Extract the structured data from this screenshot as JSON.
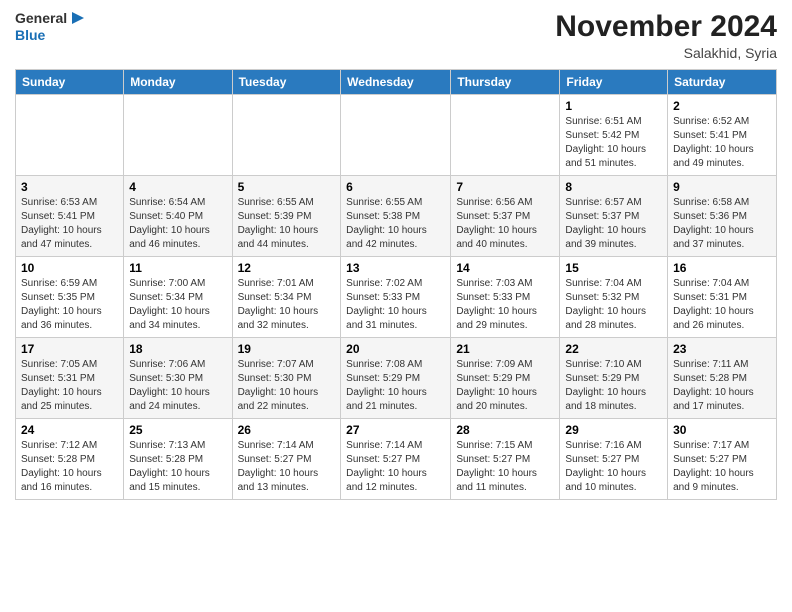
{
  "header": {
    "logo_general": "General",
    "logo_blue": "Blue",
    "month": "November 2024",
    "location": "Salakhid, Syria"
  },
  "days_of_week": [
    "Sunday",
    "Monday",
    "Tuesday",
    "Wednesday",
    "Thursday",
    "Friday",
    "Saturday"
  ],
  "weeks": [
    [
      {
        "day": "",
        "info": ""
      },
      {
        "day": "",
        "info": ""
      },
      {
        "day": "",
        "info": ""
      },
      {
        "day": "",
        "info": ""
      },
      {
        "day": "",
        "info": ""
      },
      {
        "day": "1",
        "info": "Sunrise: 6:51 AM\nSunset: 5:42 PM\nDaylight: 10 hours\nand 51 minutes."
      },
      {
        "day": "2",
        "info": "Sunrise: 6:52 AM\nSunset: 5:41 PM\nDaylight: 10 hours\nand 49 minutes."
      }
    ],
    [
      {
        "day": "3",
        "info": "Sunrise: 6:53 AM\nSunset: 5:41 PM\nDaylight: 10 hours\nand 47 minutes."
      },
      {
        "day": "4",
        "info": "Sunrise: 6:54 AM\nSunset: 5:40 PM\nDaylight: 10 hours\nand 46 minutes."
      },
      {
        "day": "5",
        "info": "Sunrise: 6:55 AM\nSunset: 5:39 PM\nDaylight: 10 hours\nand 44 minutes."
      },
      {
        "day": "6",
        "info": "Sunrise: 6:55 AM\nSunset: 5:38 PM\nDaylight: 10 hours\nand 42 minutes."
      },
      {
        "day": "7",
        "info": "Sunrise: 6:56 AM\nSunset: 5:37 PM\nDaylight: 10 hours\nand 40 minutes."
      },
      {
        "day": "8",
        "info": "Sunrise: 6:57 AM\nSunset: 5:37 PM\nDaylight: 10 hours\nand 39 minutes."
      },
      {
        "day": "9",
        "info": "Sunrise: 6:58 AM\nSunset: 5:36 PM\nDaylight: 10 hours\nand 37 minutes."
      }
    ],
    [
      {
        "day": "10",
        "info": "Sunrise: 6:59 AM\nSunset: 5:35 PM\nDaylight: 10 hours\nand 36 minutes."
      },
      {
        "day": "11",
        "info": "Sunrise: 7:00 AM\nSunset: 5:34 PM\nDaylight: 10 hours\nand 34 minutes."
      },
      {
        "day": "12",
        "info": "Sunrise: 7:01 AM\nSunset: 5:34 PM\nDaylight: 10 hours\nand 32 minutes."
      },
      {
        "day": "13",
        "info": "Sunrise: 7:02 AM\nSunset: 5:33 PM\nDaylight: 10 hours\nand 31 minutes."
      },
      {
        "day": "14",
        "info": "Sunrise: 7:03 AM\nSunset: 5:33 PM\nDaylight: 10 hours\nand 29 minutes."
      },
      {
        "day": "15",
        "info": "Sunrise: 7:04 AM\nSunset: 5:32 PM\nDaylight: 10 hours\nand 28 minutes."
      },
      {
        "day": "16",
        "info": "Sunrise: 7:04 AM\nSunset: 5:31 PM\nDaylight: 10 hours\nand 26 minutes."
      }
    ],
    [
      {
        "day": "17",
        "info": "Sunrise: 7:05 AM\nSunset: 5:31 PM\nDaylight: 10 hours\nand 25 minutes."
      },
      {
        "day": "18",
        "info": "Sunrise: 7:06 AM\nSunset: 5:30 PM\nDaylight: 10 hours\nand 24 minutes."
      },
      {
        "day": "19",
        "info": "Sunrise: 7:07 AM\nSunset: 5:30 PM\nDaylight: 10 hours\nand 22 minutes."
      },
      {
        "day": "20",
        "info": "Sunrise: 7:08 AM\nSunset: 5:29 PM\nDaylight: 10 hours\nand 21 minutes."
      },
      {
        "day": "21",
        "info": "Sunrise: 7:09 AM\nSunset: 5:29 PM\nDaylight: 10 hours\nand 20 minutes."
      },
      {
        "day": "22",
        "info": "Sunrise: 7:10 AM\nSunset: 5:29 PM\nDaylight: 10 hours\nand 18 minutes."
      },
      {
        "day": "23",
        "info": "Sunrise: 7:11 AM\nSunset: 5:28 PM\nDaylight: 10 hours\nand 17 minutes."
      }
    ],
    [
      {
        "day": "24",
        "info": "Sunrise: 7:12 AM\nSunset: 5:28 PM\nDaylight: 10 hours\nand 16 minutes."
      },
      {
        "day": "25",
        "info": "Sunrise: 7:13 AM\nSunset: 5:28 PM\nDaylight: 10 hours\nand 15 minutes."
      },
      {
        "day": "26",
        "info": "Sunrise: 7:14 AM\nSunset: 5:27 PM\nDaylight: 10 hours\nand 13 minutes."
      },
      {
        "day": "27",
        "info": "Sunrise: 7:14 AM\nSunset: 5:27 PM\nDaylight: 10 hours\nand 12 minutes."
      },
      {
        "day": "28",
        "info": "Sunrise: 7:15 AM\nSunset: 5:27 PM\nDaylight: 10 hours\nand 11 minutes."
      },
      {
        "day": "29",
        "info": "Sunrise: 7:16 AM\nSunset: 5:27 PM\nDaylight: 10 hours\nand 10 minutes."
      },
      {
        "day": "30",
        "info": "Sunrise: 7:17 AM\nSunset: 5:27 PM\nDaylight: 10 hours\nand 9 minutes."
      }
    ]
  ]
}
